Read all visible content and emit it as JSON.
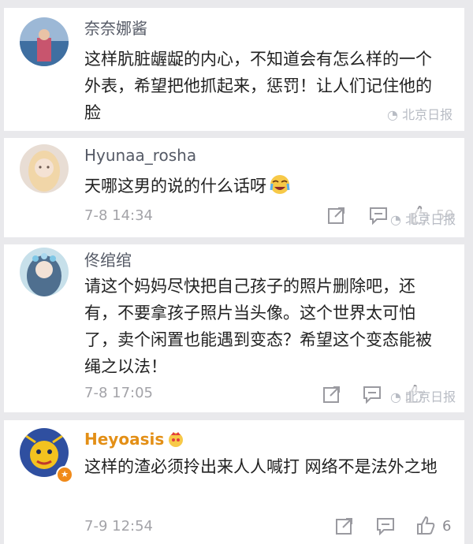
{
  "comments": [
    {
      "username": "奈奈娜酱",
      "text": "这样肮脏龌龊的内心，不知道会有怎么样的一个外表，希望把他抓起来，惩罚！让人们记住他的脸",
      "time": "",
      "likes": ""
    },
    {
      "username": "Hyunaa_rosha",
      "text": "天哪这男的说的什么话呀",
      "time": "7-8 14:34",
      "likes": "59",
      "emoji": "crying-laugh-emoji"
    },
    {
      "username": "佟绾绾",
      "text": "请这个妈妈尽快把自己孩子的照片删除吧，还有，不要拿孩子照片当头像。这个世界太可怕了，卖个闲置也能遇到变态？希望这个变态能被绳之以法！",
      "time": "7-8 17:05",
      "likes": ""
    },
    {
      "username": "Heyoasis",
      "text": "这样的渣必须拎出来人人喊打 网络不是法外之地",
      "time": "7-9 12:54",
      "likes": "6",
      "badge": "crown-emoji"
    }
  ],
  "watermark": "北京日报",
  "icons": {
    "share": "share-icon",
    "comment": "comment-icon",
    "like": "thumbs-up-icon"
  },
  "colors": {
    "background": "#e9e9ec",
    "card": "#ffffff",
    "username": "#555a66",
    "vip_username": "#e38f16",
    "text": "#222222",
    "meta": "#a3a3a8"
  }
}
